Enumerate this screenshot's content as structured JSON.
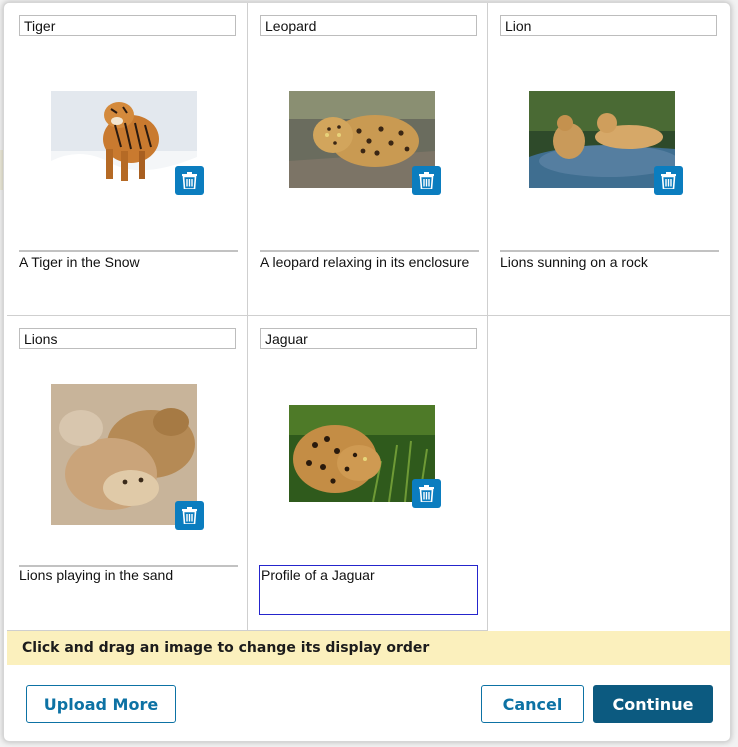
{
  "cards": [
    {
      "title": "Tiger",
      "caption": "A Tiger in the Snow",
      "image": "tiger-photo"
    },
    {
      "title": "Leopard",
      "caption": "A leopard relaxing in its enclosure",
      "image": "leopard-photo"
    },
    {
      "title": "Lion",
      "caption": "Lions sunning on a rock",
      "image": "lion-photo"
    },
    {
      "title": "Lions",
      "caption": "Lions playing in the sand",
      "image": "lions-photo"
    },
    {
      "title": "Jaguar",
      "caption": "Profile of a Jaguar",
      "image": "jaguar-photo"
    }
  ],
  "hint": "Click and drag an image to change its display order",
  "buttons": {
    "upload_more": "Upload More",
    "cancel": "Cancel",
    "continue": "Continue"
  },
  "icons": {
    "delete": "trash-icon"
  },
  "colors": {
    "accent": "#0b7dbf",
    "primary": "#0c5a80",
    "hint_background": "#fbf0bd",
    "focus_border": "#2525cc"
  }
}
